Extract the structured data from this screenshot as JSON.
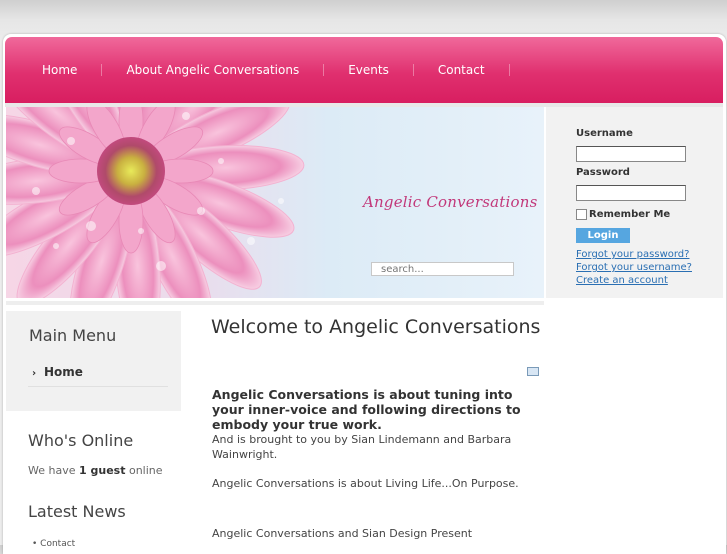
{
  "nav": {
    "items": [
      "Home",
      "About Angelic Conversations",
      "Events",
      "Contact"
    ]
  },
  "banner": {
    "title": "Angelic Conversations",
    "search_placeholder": "search..."
  },
  "login": {
    "username_label": "Username",
    "password_label": "Password",
    "remember_label": "Remember Me",
    "login_button": "Login",
    "forgot_password": "Forgot your password?",
    "forgot_username": "Forgot your username?",
    "create_account": "Create an account"
  },
  "sidebar": {
    "main_menu_title": "Main Menu",
    "main_menu_items": [
      "Home"
    ],
    "whos_online_title": "Who's Online",
    "whos_online_prefix": "We have",
    "whos_online_count": "1 guest",
    "whos_online_suffix": "online",
    "latest_news_title": "Latest News",
    "latest_news_items": [
      "Contact"
    ]
  },
  "article": {
    "title": "Welcome to Angelic Conversations",
    "intro": "Angelic Conversations is about tuning into your inner-voice and following directions to embody your true work.",
    "p1": "And is brought to you by Sian Lindemann and Barbara Wainwright.",
    "p2": "Angelic Conversations is about Living Life...On Purpose.",
    "p3": "Angelic Conversations and Sian Design Present"
  },
  "colors": {
    "nav_pink": "#e0306f",
    "title_pink": "#c2387a",
    "link_blue": "#2a6fb3",
    "button_blue": "#56a6e0"
  }
}
